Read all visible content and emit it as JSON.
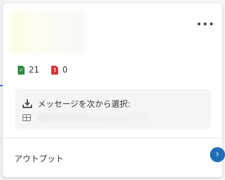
{
  "stats": [
    {
      "icon": "success-file-icon",
      "value": "21"
    },
    {
      "icon": "error-file-icon",
      "value": "0"
    }
  ],
  "selection": {
    "label": "メッセージを次から選択:"
  },
  "output": {
    "label": "アウトプット"
  },
  "icons": {
    "more": "more-horizontal-icon",
    "download": "download-icon",
    "table": "table-icon",
    "next": "chevron-right-icon"
  },
  "colors": {
    "success": "#2f8a3c",
    "error": "#d4343a",
    "accent": "#1f6fb8"
  }
}
